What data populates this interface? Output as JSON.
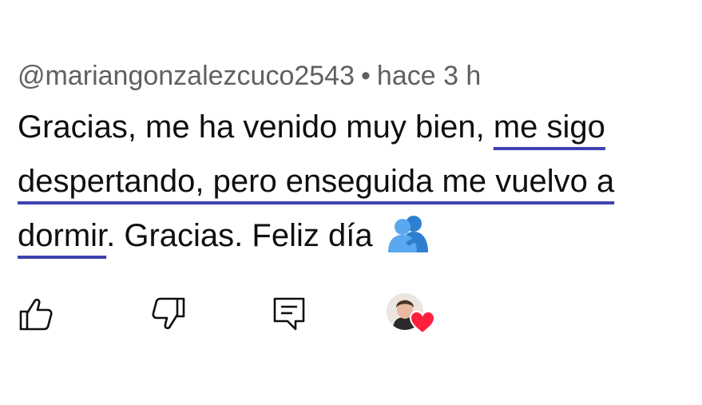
{
  "comment": {
    "author": "@mariangonzalezcuco2543",
    "separator": "•",
    "time": "hace 3 h",
    "text_part1": "Gracias, me ha venido muy bien, ",
    "text_highlight": "me sigo despertando, pero enseguida me vuelvo a dormir",
    "text_part2": ". Gracias. Feliz día",
    "emoji": "people-hugging-emoji"
  },
  "actions": {
    "like_icon": "thumbs-up-icon",
    "dislike_icon": "thumbs-down-icon",
    "reply_icon": "comment-reply-icon",
    "creator_heart": "creator-heart-avatar"
  },
  "colors": {
    "text": "#0f0f0f",
    "meta": "#606060",
    "underline": "#3d42b0",
    "heart": "#ff1f3d",
    "emoji": "#4a9de8"
  }
}
